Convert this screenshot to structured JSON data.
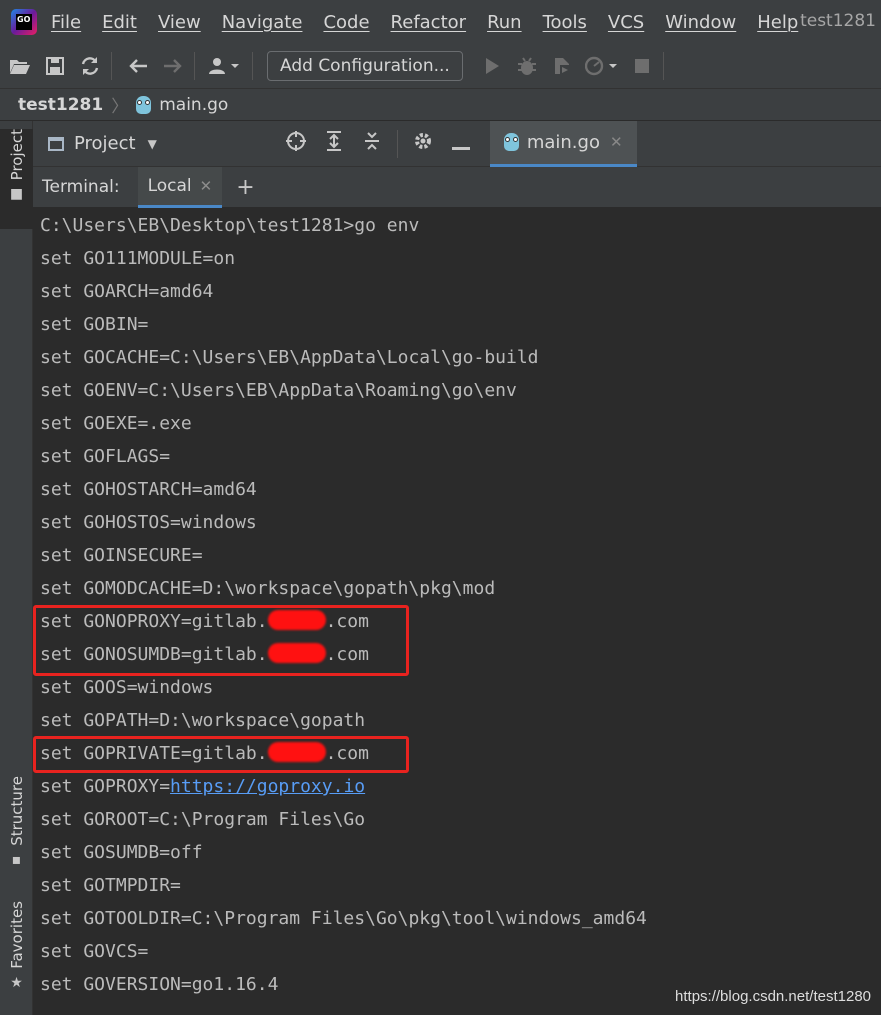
{
  "menubar": {
    "items": [
      "File",
      "Edit",
      "View",
      "Navigate",
      "Code",
      "Refactor",
      "Run",
      "Tools",
      "VCS",
      "Window",
      "Help"
    ],
    "project_title": "test1281"
  },
  "toolbar": {
    "add_configuration_label": "Add Configuration..."
  },
  "breadcrumb": {
    "project": "test1281",
    "file": "main.go"
  },
  "left_strip": {
    "project_tab": "Project",
    "structure_tab": "Structure",
    "favorites_tab": "Favorites"
  },
  "tool_header": {
    "project_label": "Project",
    "editor_tab": "main.go"
  },
  "terminal": {
    "title": "Terminal:",
    "tab_label": "Local",
    "prompt": "C:\\Users\\EB\\Desktop\\test1281>go env",
    "lines": [
      "set GO111MODULE=on",
      "set GOARCH=amd64",
      "set GOBIN=",
      "set GOCACHE=C:\\Users\\EB\\AppData\\Local\\go-build",
      "set GOENV=C:\\Users\\EB\\AppData\\Roaming\\go\\env",
      "set GOEXE=.exe",
      "set GOFLAGS=",
      "set GOHOSTARCH=amd64",
      "set GOHOSTOS=windows",
      "set GOINSECURE=",
      "set GOMODCACHE=D:\\workspace\\gopath\\pkg\\mod"
    ],
    "noproxy_prefix": "set GONOPROXY=gitlab.",
    "nosumdb_prefix": "set GONOSUMDB=gitlab.",
    "domain_suffix": ".com",
    "goos": "set GOOS=windows",
    "gopath": "set GOPATH=D:\\workspace\\gopath",
    "private_prefix": "set GOPRIVATE=gitlab.",
    "proxy_prefix": "set GOPROXY=",
    "proxy_url": "https://goproxy.io",
    "lines_after": [
      "set GOROOT=C:\\Program Files\\Go",
      "set GOSUMDB=off",
      "set GOTMPDIR=",
      "set GOTOOLDIR=C:\\Program Files\\Go\\pkg\\tool\\windows_amd64",
      "set GOVCS=",
      "set GOVERSION=go1.16.4"
    ]
  },
  "watermark": "https://blog.csdn.net/test1280",
  "colors": {
    "highlight_box": "#e8231f",
    "redaction": "#ff1111",
    "link": "#589df6"
  }
}
